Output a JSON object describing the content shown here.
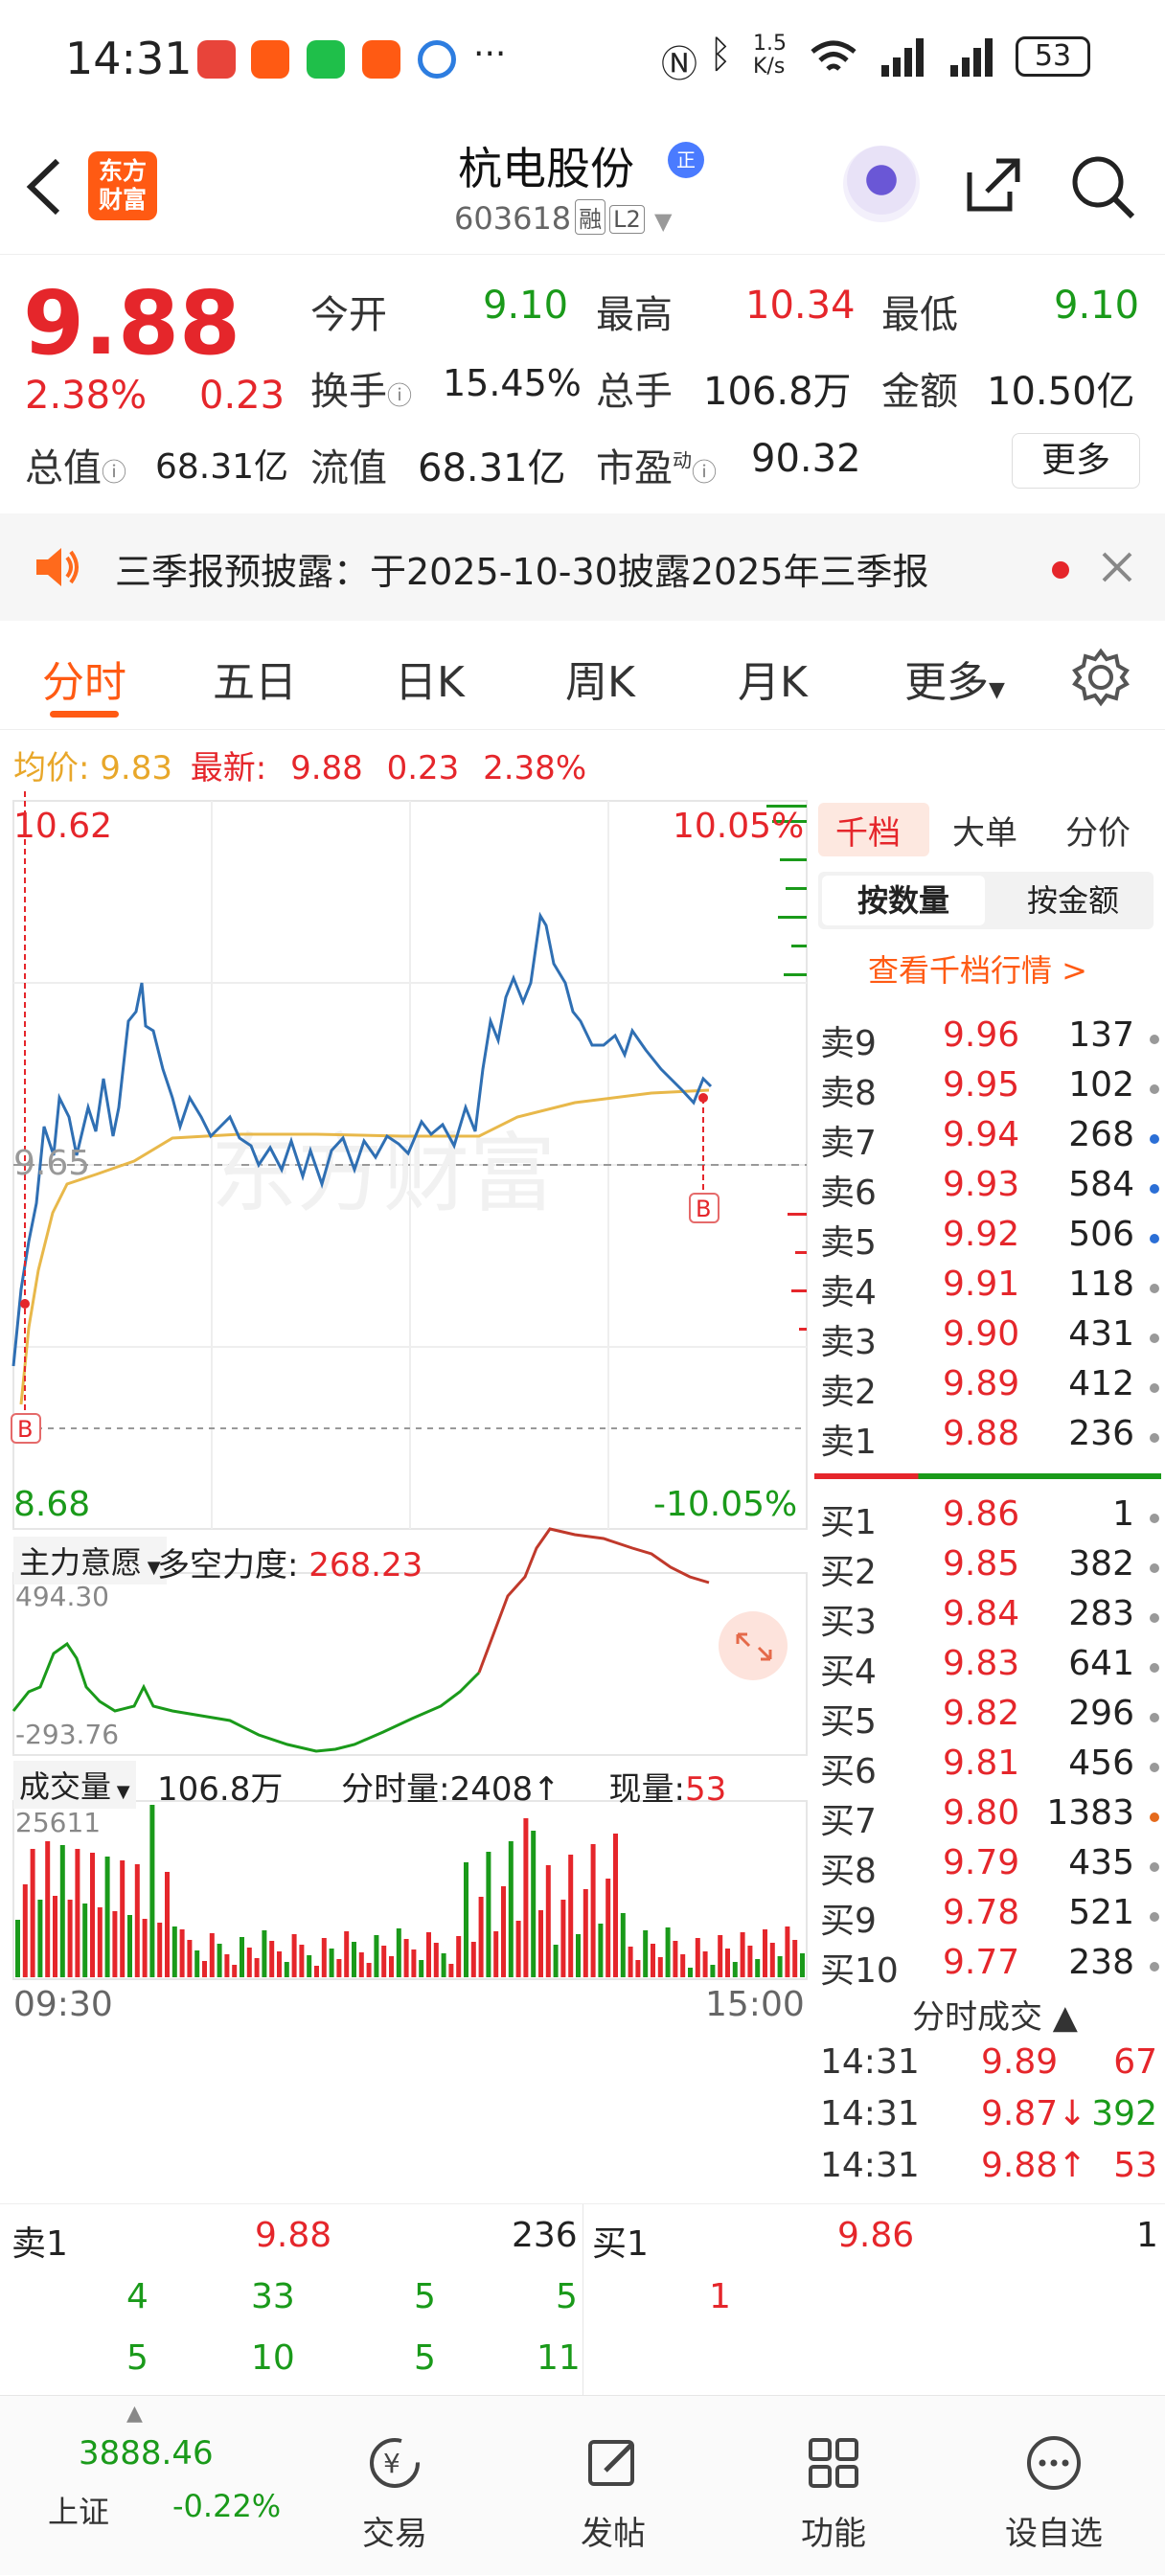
{
  "status_bar": {
    "time": "14:31",
    "net_speed": "1.5\nK/s",
    "battery": "53"
  },
  "header": {
    "back_icon": "back-arrow-icon",
    "logo_text": "东方\n财富",
    "stock_name": "杭电股份",
    "badge": "正",
    "code": "603618",
    "tag_margin": "融",
    "tag_level": "L2"
  },
  "quote": {
    "price": "9.88",
    "change_pct": "2.38%",
    "change": "0.23",
    "open_label": "今开",
    "open": "9.10",
    "high_label": "最高",
    "high": "10.34",
    "low_label": "最低",
    "low": "9.10",
    "turnover_label": "换手",
    "turnover": "15.45%",
    "volume_label": "总手",
    "volume": "106.8万",
    "amount_label": "金额",
    "amount": "10.50亿",
    "mktcap_label": "总值",
    "mktcap": "68.31亿",
    "float_label": "流值",
    "float": "68.31亿",
    "pe_label": "市盈",
    "pe_sup": "动",
    "pe": "90.32",
    "more": "更多"
  },
  "notice": {
    "text": "三季报预披露：于2025-10-30披露2025年三季报"
  },
  "tabs": [
    "分时",
    "五日",
    "日K",
    "周K",
    "月K",
    "更多"
  ],
  "avg_row": {
    "avg_label": "均价:",
    "avg": "9.83",
    "latest_label": "最新:",
    "latest": "9.88",
    "chg": "0.23",
    "pct": "2.38%"
  },
  "chart": {
    "y_top": "10.62",
    "y_mid": "9.65",
    "y_bottom": "8.68",
    "pct_top": "10.05%",
    "pct_bottom": "-10.05%",
    "watermark": "东方财富",
    "indicator_label": "主力意愿",
    "indicator_name": "多空力度:",
    "indicator_value": "268.23",
    "ind_top": "494.30",
    "ind_bottom": "-293.76",
    "vol_label": "成交量",
    "vol_total": "106.8万",
    "vol_min_label": "分时量:",
    "vol_min": "2408",
    "vol_now_label": "现量:",
    "vol_now": "53",
    "vol_max": "25611",
    "time_start": "09:30",
    "time_end": "15:00"
  },
  "right_panel": {
    "tabs": [
      "千档",
      "大单",
      "分价"
    ],
    "sub_tabs": [
      "按数量",
      "按金额"
    ],
    "link": "查看千档行情 >",
    "asks": [
      {
        "label": "卖9",
        "price": "9.96",
        "vol": "137",
        "dot": "#999"
      },
      {
        "label": "卖8",
        "price": "9.95",
        "vol": "102",
        "dot": "#999"
      },
      {
        "label": "卖7",
        "price": "9.94",
        "vol": "268",
        "dot": "#2b6fd6"
      },
      {
        "label": "卖6",
        "price": "9.93",
        "vol": "584",
        "dot": "#2b6fd6"
      },
      {
        "label": "卖5",
        "price": "9.92",
        "vol": "506",
        "dot": "#2b6fd6"
      },
      {
        "label": "卖4",
        "price": "9.91",
        "vol": "118",
        "dot": "#999"
      },
      {
        "label": "卖3",
        "price": "9.90",
        "vol": "431",
        "dot": "#999"
      },
      {
        "label": "卖2",
        "price": "9.89",
        "vol": "412",
        "dot": "#999"
      },
      {
        "label": "卖1",
        "price": "9.88",
        "vol": "236",
        "dot": "#999"
      }
    ],
    "bids": [
      {
        "label": "买1",
        "price": "9.86",
        "vol": "1",
        "dot": "#999"
      },
      {
        "label": "买2",
        "price": "9.85",
        "vol": "382",
        "dot": "#999"
      },
      {
        "label": "买3",
        "price": "9.84",
        "vol": "283",
        "dot": "#999"
      },
      {
        "label": "买4",
        "price": "9.83",
        "vol": "641",
        "dot": "#999"
      },
      {
        "label": "买5",
        "price": "9.82",
        "vol": "296",
        "dot": "#999"
      },
      {
        "label": "买6",
        "price": "9.81",
        "vol": "456",
        "dot": "#999"
      },
      {
        "label": "买7",
        "price": "9.80",
        "vol": "1383",
        "dot": "#e56a1c"
      },
      {
        "label": "买8",
        "price": "9.79",
        "vol": "435",
        "dot": "#999"
      },
      {
        "label": "买9",
        "price": "9.78",
        "vol": "521",
        "dot": "#999"
      },
      {
        "label": "买10",
        "price": "9.77",
        "vol": "238",
        "dot": "#999"
      }
    ],
    "ticks_title": "分时成交",
    "ticks": [
      {
        "time": "14:31",
        "price": "9.89",
        "vol": "67",
        "arrow": ""
      },
      {
        "time": "14:31",
        "price": "9.87↓",
        "vol": "392",
        "arrow": ""
      },
      {
        "time": "14:31",
        "price": "9.88↑",
        "vol": "53",
        "arrow": ""
      }
    ]
  },
  "bottom_orderbook": {
    "ask_label": "卖1",
    "ask_price": "9.88",
    "ask_vol": "236",
    "bid_label": "买1",
    "bid_price": "9.86",
    "bid_vol": "1",
    "ask_row1": [
      "4",
      "33",
      "5",
      "5"
    ],
    "ask_row2": [
      "5",
      "10",
      "5",
      "11"
    ],
    "bid_row1": [
      "1"
    ]
  },
  "nav": {
    "index_value": "3888.46",
    "index_name": "上证",
    "index_change": "-0.22%",
    "items": [
      "交易",
      "发帖",
      "功能",
      "设自选"
    ]
  }
}
